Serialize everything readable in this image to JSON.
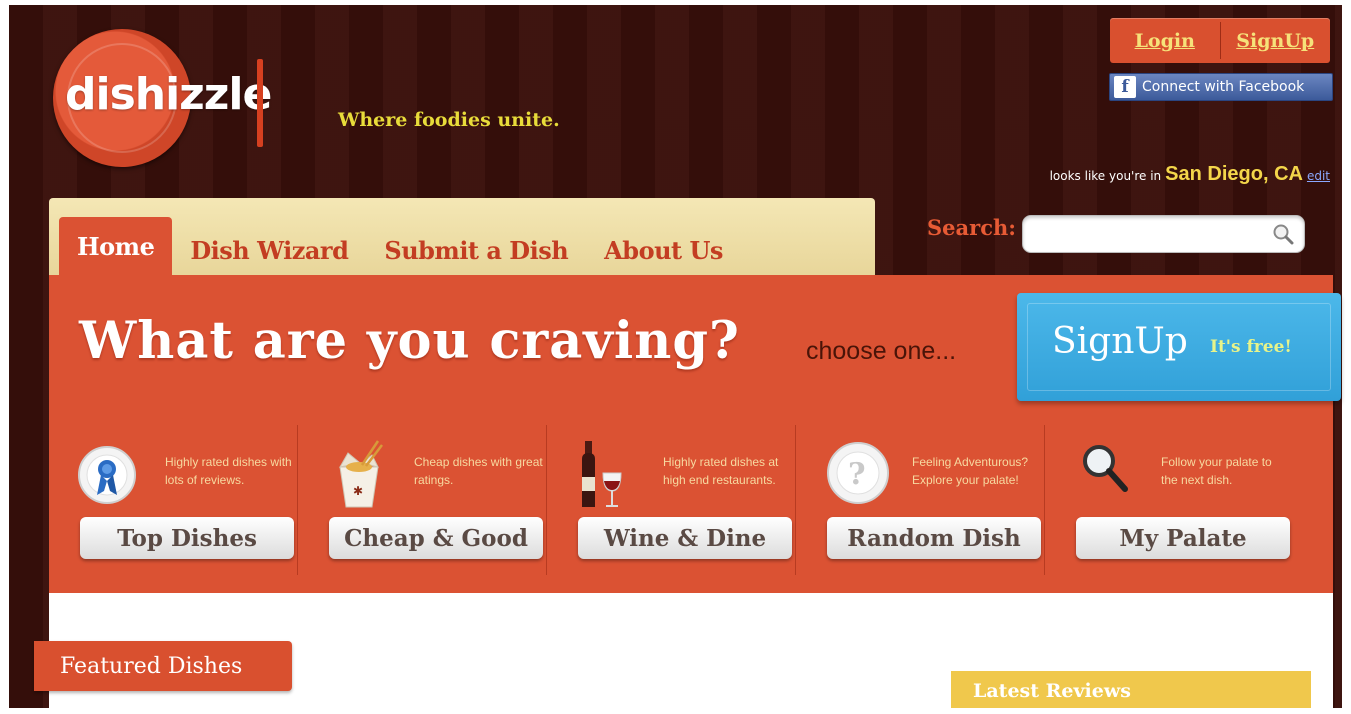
{
  "header": {
    "logo_text": "dishizzle",
    "tagline": "Where foodies unite.",
    "auth": {
      "login_label": "Login",
      "signup_label": "SignUp"
    },
    "facebook_label": "Connect with Facebook",
    "facebook_icon": "f",
    "location": {
      "prefix": "looks like you're in",
      "city": "San Diego, CA",
      "edit_label": "edit"
    }
  },
  "nav": {
    "tabs": [
      {
        "label": "Home",
        "active": true
      },
      {
        "label": "Dish Wizard",
        "active": false
      },
      {
        "label": "Submit a Dish",
        "active": false
      },
      {
        "label": "About Us",
        "active": false
      }
    ]
  },
  "search": {
    "label": "Search:",
    "value": "",
    "placeholder": ""
  },
  "hero": {
    "headline": "What are you craving?",
    "subhead": "choose one...",
    "signup": {
      "big": "SignUp",
      "small": "It's free!"
    }
  },
  "categories": [
    {
      "icon": "ribbon-award-icon",
      "desc": "Highly rated dishes with lots of reviews.",
      "button": "Top Dishes"
    },
    {
      "icon": "takeout-box-icon",
      "desc": "Cheap dishes with great ratings.",
      "button": "Cheap & Good"
    },
    {
      "icon": "wine-bottle-glass-icon",
      "desc": "Highly rated dishes at high end restaurants.",
      "button": "Wine & Dine"
    },
    {
      "icon": "question-plate-icon",
      "desc": "Feeling Adventurous? Explore your palate!",
      "button": "Random Dish"
    },
    {
      "icon": "magnifier-icon",
      "desc": "Follow your palate to the next dish.",
      "button": "My Palate"
    }
  ],
  "lower": {
    "featured_label": "Featured Dishes",
    "latest_label": "Latest Reviews"
  },
  "colors": {
    "brand_red": "#db5233",
    "background": "#3a100b",
    "accent_yellow": "#e8dc3a",
    "signup_blue": "#3aaee2"
  }
}
